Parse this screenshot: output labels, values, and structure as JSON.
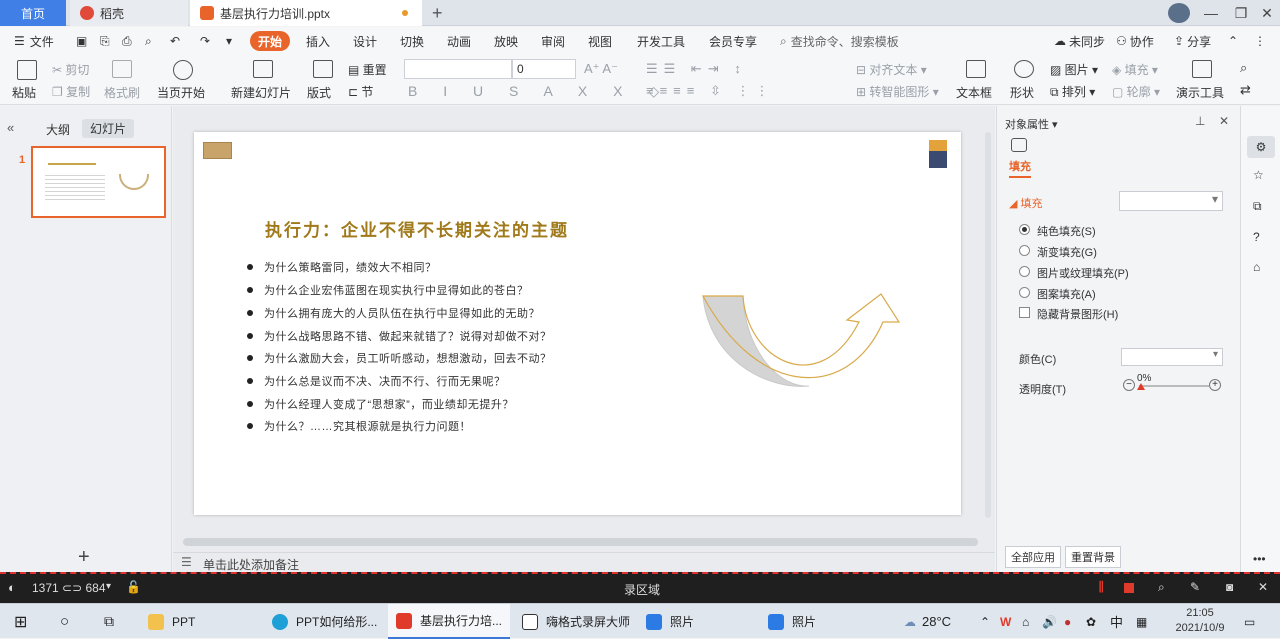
{
  "tabs": {
    "home": "首页",
    "daoke": "稻壳",
    "doc": "基层执行力培训.pptx"
  },
  "menu": {
    "file": "文件",
    "items": [
      "开始",
      "插入",
      "设计",
      "切换",
      "动画",
      "放映",
      "审阅",
      "视图",
      "开发工具",
      "会员专享"
    ],
    "search": "查找命令、搜索模板",
    "sync": "未同步",
    "collab": "协作",
    "share": "分享"
  },
  "toolbar": {
    "paste": "粘贴",
    "cut": "剪切",
    "copy": "复制",
    "format_painter": "格式刷",
    "play_current": "当页开始",
    "new_slide": "新建幻灯片",
    "layout": "版式",
    "reset": "重置",
    "section": "节",
    "font_size": "0",
    "align_text": "对齐文本",
    "smart_art": "转智能图形",
    "textbox": "文本框",
    "shape": "形状",
    "picture": "图片",
    "arrange": "排列",
    "fill": "填充",
    "outline": "轮廓",
    "present_tools": "演示工具"
  },
  "left_panel": {
    "tab_outline": "大纲",
    "tab_slides": "幻灯片",
    "slide_number": "1",
    "add": "+"
  },
  "slide": {
    "title": "执行力：企业不得不长期关注的主题",
    "bullets": [
      "为什么策略雷同，绩效大不相同？",
      "为什么企业宏伟蓝图在现实执行中显得如此的苍白？",
      "为什么拥有庞大的人员队伍在执行中显得如此的无助？",
      "为什么战略思路不错、做起来就错了？说得对却做不对？",
      "为什么激励大会，员工听听感动，想想激动，回去不动？",
      "为什么总是议而不决、决而不行、行而无果呢？",
      "为什么经理人变成了“思想家”，而业绩却无提升？",
      "为什么？……究其根源就是执行力问题！"
    ]
  },
  "notes_placeholder": "单击此处添加备注",
  "right_panel": {
    "header": "对象属性",
    "fill_tab": "填充",
    "fill_section": "填充",
    "options": [
      "纯色填充(S)",
      "渐变填充(G)",
      "图片或纹理填充(P)",
      "图案填充(A)"
    ],
    "hide_bg": "隐藏背景图形(H)",
    "color_label": "颜色(C)",
    "transparency_label": "透明度(T)",
    "transparency_value": "0%",
    "apply_all": "全部应用",
    "reset_bg": "重置背景"
  },
  "recorder": {
    "dims": "1371 ⊂⊃ 684",
    "label": "录区域"
  },
  "taskbar": {
    "items": [
      "PPT",
      "PPT如何给形...",
      "基层执行力培...",
      "嗨格式录屏大师",
      "照片",
      "照片"
    ],
    "temperature": "28°C",
    "ime": "中",
    "time": "21:05",
    "date": "2021/10/9"
  },
  "colors": {
    "accent": "#e8642a",
    "title_gold": "#a07a1a",
    "arrow_gray": "#d4d4d4",
    "arrow_outline": "#d9a94a"
  }
}
